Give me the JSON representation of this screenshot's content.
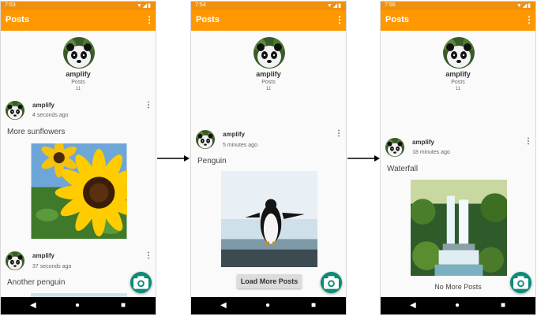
{
  "screens": [
    {
      "status_time": "7:53",
      "status_icons": "▼◢▮",
      "app_title": "Posts",
      "more_icon": "⋮",
      "profile": {
        "username": "amplify",
        "posts_label": "Posts",
        "posts_count": "11"
      },
      "posts": [
        {
          "user": "amplify",
          "time": "4 seconds ago",
          "caption": "More sunflowers",
          "image": "sunflower"
        },
        {
          "user": "amplify",
          "time": "37 seconds ago",
          "caption": "Another penguin",
          "image": "penguin"
        }
      ]
    },
    {
      "status_time": "7:54",
      "status_icons": "▼◢▮",
      "app_title": "Posts",
      "more_icon": "⋮",
      "profile": {
        "username": "amplify",
        "posts_label": "Posts",
        "posts_count": "11"
      },
      "posts": [
        {
          "user": "amplify",
          "time": "5 minutes ago",
          "caption": "Penguin",
          "image": "penguin"
        }
      ],
      "load_more_label": "Load More Posts"
    },
    {
      "status_time": "7:56",
      "status_icons": "▼◢▮",
      "app_title": "Posts",
      "more_icon": "⋮",
      "profile": {
        "username": "amplify",
        "posts_label": "Posts",
        "posts_count": "11"
      },
      "posts": [
        {
          "user": "amplify",
          "time": "18 minutes ago",
          "caption": "Waterfall",
          "image": "waterfall"
        }
      ],
      "no_more_label": "No More Posts"
    }
  ],
  "nav_buttons": {
    "back": "◀",
    "home": "●",
    "recents": "■"
  },
  "colors": {
    "app_bar": "#ff9800",
    "status_bar": "#f0900f",
    "fab": "#0e8a78"
  }
}
